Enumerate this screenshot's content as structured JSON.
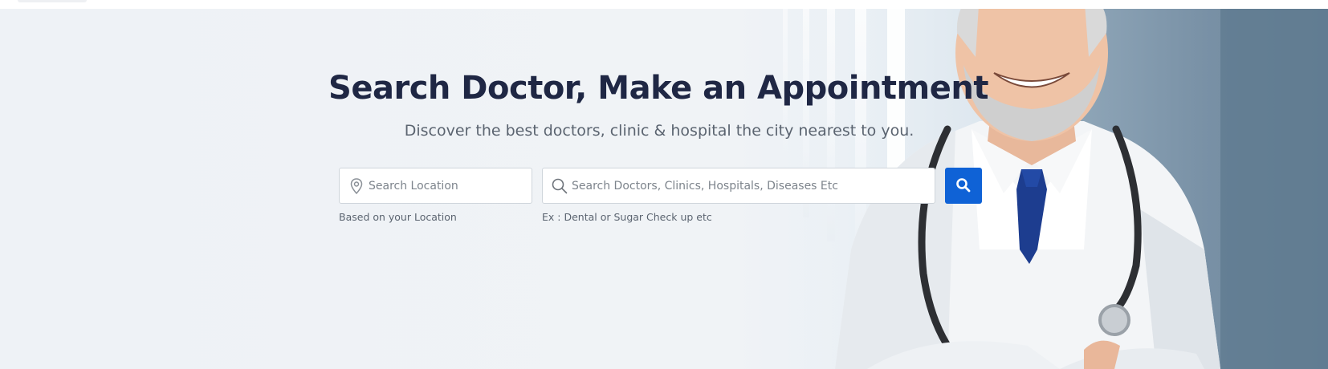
{
  "hero": {
    "title": "Search Doctor, Make an Appointment",
    "subtitle": "Discover the best doctors, clinic & hospital the city nearest to you."
  },
  "search": {
    "location": {
      "placeholder": "Search Location",
      "value": "",
      "hint": "Based on your Location",
      "icon": "map-pin-icon"
    },
    "query": {
      "placeholder": "Search Doctors, Clinics, Hospitals, Diseases Etc",
      "value": "",
      "hint": "Ex : Dental or Sugar Check up etc",
      "icon": "search-icon"
    },
    "button": {
      "icon": "search-icon",
      "color": "#0f62d6"
    }
  },
  "colors": {
    "title": "#1f2744",
    "subtitle": "#5b6470",
    "accent": "#0f62d6"
  }
}
